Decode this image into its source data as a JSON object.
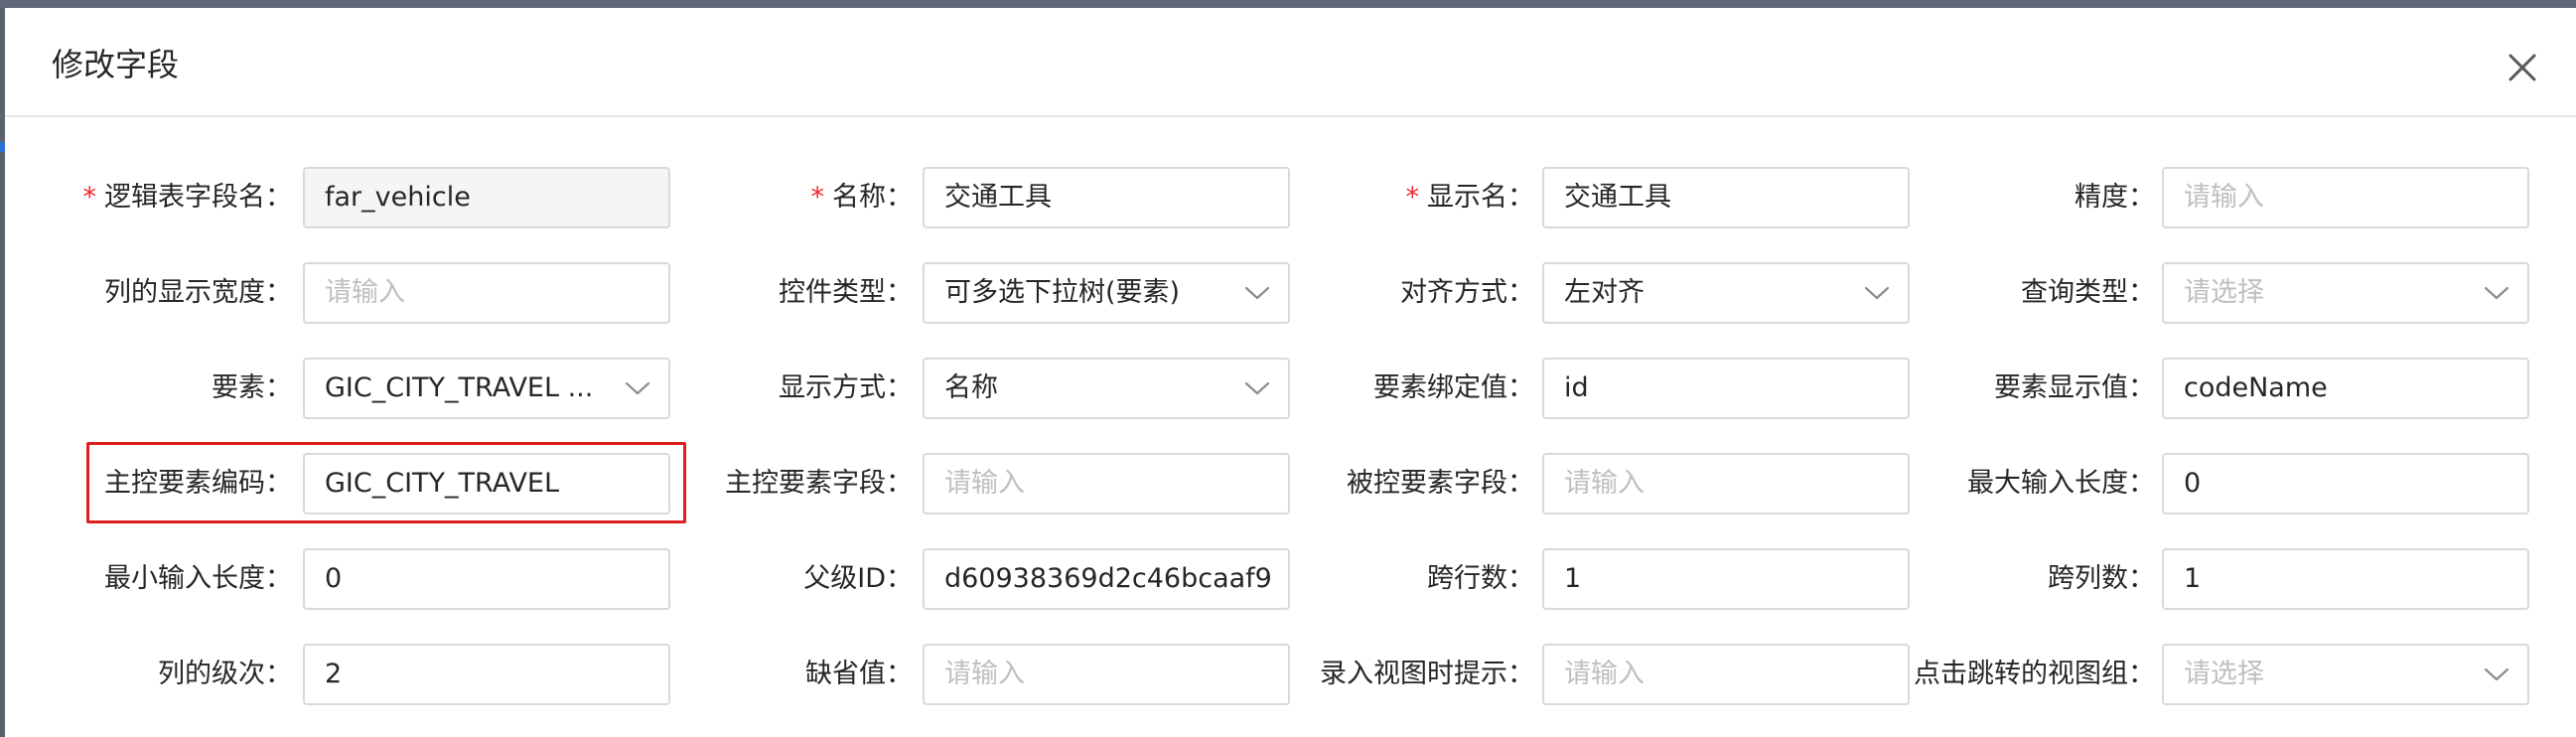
{
  "dialog": {
    "title": "修改字段"
  },
  "required_mark": "*",
  "rows": [
    [
      {
        "label": "逻辑表字段名：",
        "required": true,
        "type": "input",
        "value": "far_vehicle",
        "disabled": true
      },
      {
        "label": "名称：",
        "required": true,
        "type": "input",
        "value": "交通工具"
      },
      {
        "label": "显示名：",
        "required": true,
        "type": "input",
        "value": "交通工具"
      },
      {
        "label": "精度：",
        "type": "input",
        "placeholder": "请输入"
      }
    ],
    [
      {
        "label": "列的显示宽度：",
        "type": "input",
        "placeholder": "请输入"
      },
      {
        "label": "控件类型：",
        "type": "select",
        "value": "可多选下拉树(要素)"
      },
      {
        "label": "对齐方式：",
        "type": "select",
        "value": "左对齐"
      },
      {
        "label": "查询类型：",
        "type": "select",
        "placeholder": "请选择"
      }
    ],
    [
      {
        "label": "要素：",
        "type": "select",
        "value": "GIC_CITY_TRAVEL ...",
        "ellipsis": true
      },
      {
        "label": "显示方式：",
        "type": "select",
        "value": "名称"
      },
      {
        "label": "要素绑定值：",
        "type": "input",
        "value": "id"
      },
      {
        "label": "要素显示值：",
        "type": "input",
        "value": "codeName"
      }
    ],
    [
      {
        "label": "主控要素编码：",
        "type": "input",
        "value": "GIC_CITY_TRAVEL",
        "highlighted": true
      },
      {
        "label": "主控要素字段：",
        "type": "input",
        "placeholder": "请输入"
      },
      {
        "label": "被控要素字段：",
        "type": "input",
        "placeholder": "请输入"
      },
      {
        "label": "最大输入长度：",
        "type": "input",
        "value": "0"
      }
    ],
    [
      {
        "label": "最小输入长度：",
        "type": "input",
        "value": "0"
      },
      {
        "label": "父级ID：",
        "type": "input",
        "value": "d60938369d2c46bcaaf9"
      },
      {
        "label": "跨行数：",
        "type": "input",
        "value": "1"
      },
      {
        "label": "跨列数：",
        "type": "input",
        "value": "1"
      }
    ],
    [
      {
        "label": "列的级次：",
        "type": "input",
        "value": "2"
      },
      {
        "label": "缺省值：",
        "type": "input",
        "placeholder": "请输入"
      },
      {
        "label": "录入视图时提示：",
        "type": "input",
        "placeholder": "请输入"
      },
      {
        "label": "点击跳转的视图组：",
        "type": "select",
        "placeholder": "请选择"
      }
    ]
  ],
  "icons": {
    "close": "close-icon",
    "chevron": "chevron-down-icon"
  },
  "colors": {
    "required": "#f5222d",
    "highlight": "#e01e1e",
    "border": "#d9d9d9",
    "placeholder": "#bfbfbf",
    "disabled_bg": "#f5f5f5"
  }
}
